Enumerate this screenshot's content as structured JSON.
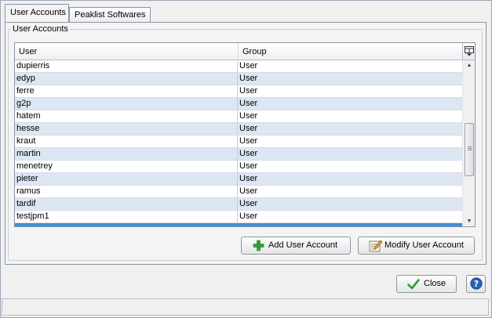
{
  "tabs": [
    {
      "label": "User Accounts",
      "active": true
    },
    {
      "label": "Peaklist Softwares",
      "active": false
    }
  ],
  "group": {
    "title": "User Accounts"
  },
  "table": {
    "columns": [
      "User",
      "Group"
    ],
    "rows": [
      {
        "user": "dupierris",
        "group": "User"
      },
      {
        "user": "edyp",
        "group": "User"
      },
      {
        "user": "ferre",
        "group": "User"
      },
      {
        "user": "g2p",
        "group": "User"
      },
      {
        "user": "hatem",
        "group": "User"
      },
      {
        "user": "hesse",
        "group": "User"
      },
      {
        "user": "kraut",
        "group": "User"
      },
      {
        "user": "martin",
        "group": "User"
      },
      {
        "user": "menetrey",
        "group": "User"
      },
      {
        "user": "pieter",
        "group": "User"
      },
      {
        "user": "ramus",
        "group": "User"
      },
      {
        "user": "tardif",
        "group": "User"
      },
      {
        "user": "testjpm1",
        "group": "User"
      }
    ]
  },
  "buttons": {
    "add": "Add User Account",
    "modify": "Modify User Account",
    "close": "Close"
  },
  "icons": {
    "add": "plus-icon",
    "modify": "edit-icon",
    "close": "check-icon",
    "help": "help-icon",
    "column_menu": "column-chooser-icon"
  },
  "colors": {
    "selection": "#3d8ee0",
    "row_alt": "#dde6f3",
    "accent_green": "#33a533",
    "help_blue": "#2b5fb8"
  }
}
